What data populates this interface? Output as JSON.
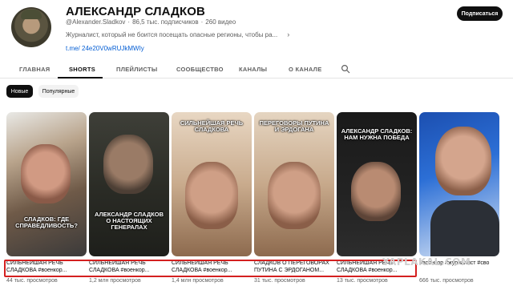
{
  "channel": {
    "name": "АЛЕКСАНДР СЛАДКОВ",
    "handle": "@Alexander.Sladkov",
    "subscribers": "86,5 тыс. подписчиков",
    "videos": "260 видео",
    "description": "Журналист, который не боится посещать опасные регионы, чтобы ра...",
    "link": "t.me/ 24e20V0wRUJkMWIy",
    "subscribe_label": "Подписаться"
  },
  "tabs": [
    "ГЛАВНАЯ",
    "SHORTS",
    "ПЛЕЙЛИСТЫ",
    "СООБЩЕСТВО",
    "КАНАЛЫ",
    "О КАНАЛЕ"
  ],
  "active_tab": "SHORTS",
  "chips": {
    "active": "Новые",
    "idle": "Популярные"
  },
  "shorts": [
    {
      "caption": "СЛАДКОВ: ГДЕ СПРАВЕДЛИВОСТЬ?",
      "title_line1": "СИЛЬНЕЙШАЯ РЕЧЬ",
      "title_line2": "СЛАДКОВА #военкор...",
      "views": "44 тыс. просмотров"
    },
    {
      "caption": "АЛЕКСАНДР СЛАДКОВ О НАСТОЯЩИХ ГЕНЕРАЛАХ",
      "title_line1": "СИЛЬНЕЙШАЯ РЕЧЬ",
      "title_line2": "СЛАДКОВА #военкор...",
      "views": "1,2 млн просмотров"
    },
    {
      "caption": "СИЛЬНЕЙШАЯ РЕЧЬ СЛАДКОВА",
      "title_line1": "СИЛЬНЕЙШАЯ РЕЧЬ",
      "title_line2": "СЛАДКОВА #военкор...",
      "views": "1,4 млн просмотров"
    },
    {
      "caption": "ПЕРЕГОВОРЫ ПУТИНА И ЭРДОГАНА",
      "title_line1": "СЛАДКОВ О ПЕРЕГОВОРАХ",
      "title_line2": "ПУТИНА С ЭРДОГАНОМ...",
      "views": "31 тыс. просмотров"
    },
    {
      "caption": "АЛЕКСАНДР СЛАДКОВ: НАМ НУЖНА ПОБЕДА",
      "title_line1": "СИЛЬНЕЙШАЯ РЕЧЬ",
      "title_line2": "СЛАДКОВА #военкор...",
      "views": "13 тыс. просмотров"
    },
    {
      "caption": "",
      "title_line1": "#военкор #журналист #сво",
      "title_line2": "",
      "views": "666 тыс. просмотров"
    }
  ],
  "watermark": "YAPLAKAL.COM",
  "colors": {
    "accent_link": "#065fd4",
    "highlight": "#d42020",
    "subscribe_bg": "#0f0f0f"
  }
}
